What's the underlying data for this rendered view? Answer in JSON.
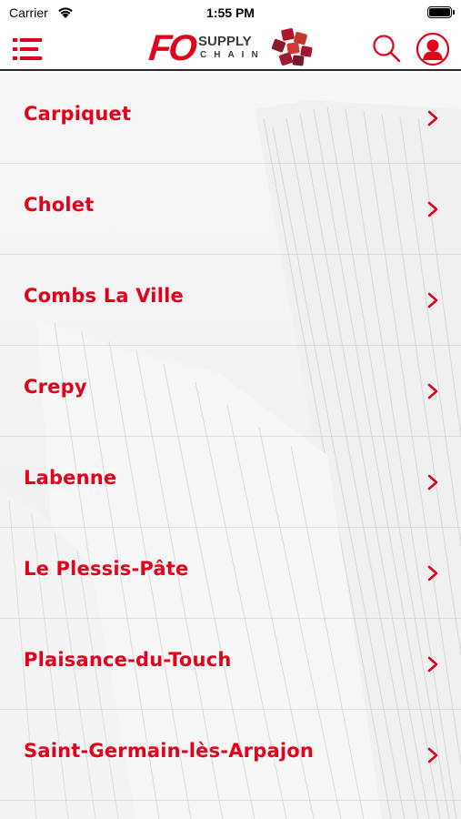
{
  "status_bar": {
    "carrier": "Carrier",
    "time": "1:55 PM"
  },
  "header": {
    "logo": {
      "brand": "FO",
      "line1": "SUPPLY",
      "line2": "CHAIN"
    },
    "icons": [
      "menu-icon",
      "search-icon",
      "account-icon"
    ]
  },
  "colors": {
    "accent": "#e2001a",
    "logo_text": "#3a3a3a"
  },
  "sites": [
    {
      "label": "Carpiquet"
    },
    {
      "label": "Cholet"
    },
    {
      "label": "Combs La Ville"
    },
    {
      "label": "Crepy"
    },
    {
      "label": "Labenne"
    },
    {
      "label": "Le Plessis-Pâte"
    },
    {
      "label": "Plaisance-du-Touch"
    },
    {
      "label": "Saint-Germain-lès-Arpajon"
    }
  ]
}
